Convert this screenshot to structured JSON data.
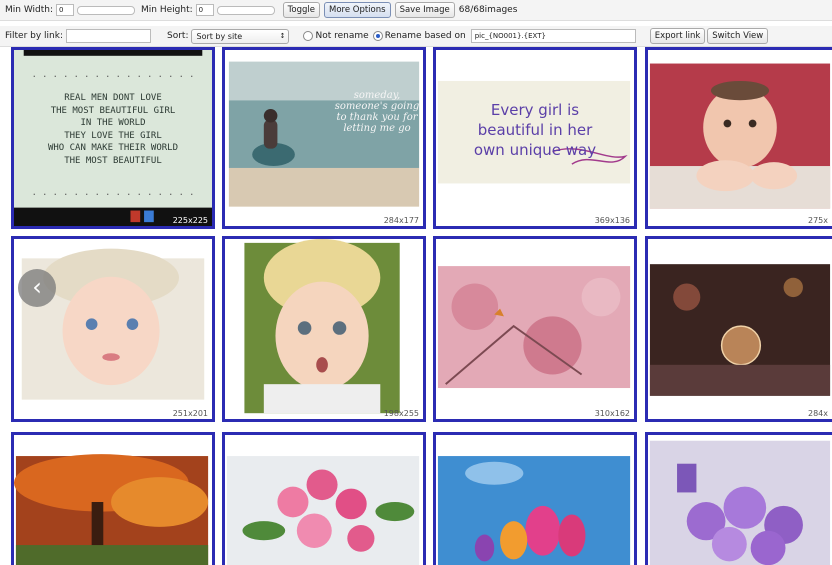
{
  "toolbar": {
    "min_width_label": "Min Width:",
    "min_width_value": "0",
    "min_height_label": "Min Height:",
    "min_height_value": "0",
    "toggle_label": "Toggle",
    "more_options_label": "More Options",
    "save_image_label": "Save Image",
    "image_count": "68/68images",
    "filter_label": "Filter by link:",
    "filter_value": "",
    "sort_label": "Sort:",
    "sort_value": "Sort by site",
    "not_rename_label": "Not rename",
    "rename_label": "Rename based on",
    "rename_pattern": "pic_{NO001}.{EXT}",
    "export_link_label": "Export link",
    "switch_view_label": "Switch View"
  },
  "images": [
    {
      "dim": "225x225",
      "text_lines": [
        "REAL MEN DONT LOVE",
        "THE MOST BEAUTIFUL GIRL",
        "IN THE WORLD",
        "THEY LOVE THE GIRL",
        "WHO CAN MAKE THEIR WORLD",
        "THE MOST BEAUTIFUL"
      ]
    },
    {
      "dim": "284x177",
      "overlay_text": "someday, someone's going to thank you for letting me go"
    },
    {
      "dim": "369x136",
      "text_lines": [
        "Every girl is",
        "beautiful in her",
        "own unique way"
      ]
    },
    {
      "dim": "275x"
    },
    {
      "dim": "251x201"
    },
    {
      "dim": "198x255"
    },
    {
      "dim": "310x162"
    },
    {
      "dim": "284x"
    },
    {
      "dim": ""
    },
    {
      "dim": ""
    },
    {
      "dim": ""
    },
    {
      "dim": ""
    }
  ],
  "colors": {
    "cell_border": "#2b2bb3",
    "accent": "#2a5cc7"
  }
}
